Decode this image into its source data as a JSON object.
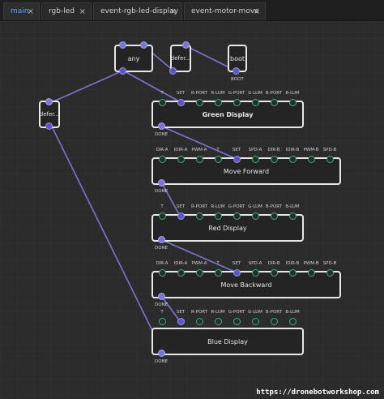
{
  "tabs": [
    {
      "label": "main",
      "close": "×"
    },
    {
      "label": "rgb-led",
      "close": "×"
    },
    {
      "label": "event-rgb-led-display",
      "close": "×"
    },
    {
      "label": "event-motor-move",
      "close": "×"
    }
  ],
  "nodes": {
    "any": {
      "title": "any"
    },
    "defer_top": {
      "title": "defer..."
    },
    "boot": {
      "title": "boot",
      "port_label": "BOOT"
    },
    "defer_left": {
      "title": "defer..."
    },
    "green": {
      "title": "Green Display"
    },
    "forward": {
      "title": "Move Forward"
    },
    "red": {
      "title": "Red Display"
    },
    "backward": {
      "title": "Move Backward"
    },
    "blue": {
      "title": "Blue Display"
    }
  },
  "led_labels": [
    "T",
    "SET",
    "R-PORT",
    "R-LUM",
    "G-PORT",
    "G-LUM",
    "B-PORT",
    "B-LUM"
  ],
  "motor_labels": [
    "DIR-A",
    "IDIR-A",
    "PWM-A",
    "T",
    "SET",
    "SPD-A",
    "DIR-B",
    "IDIR-B",
    "PWM-B",
    "SPD-B"
  ],
  "done_label": "DONE",
  "colors": {
    "accent": "#5aa6ff",
    "wire": "#7b75d6",
    "output_pin": "#3bb37a"
  },
  "watermark": "https://dronebotworkshop.com"
}
